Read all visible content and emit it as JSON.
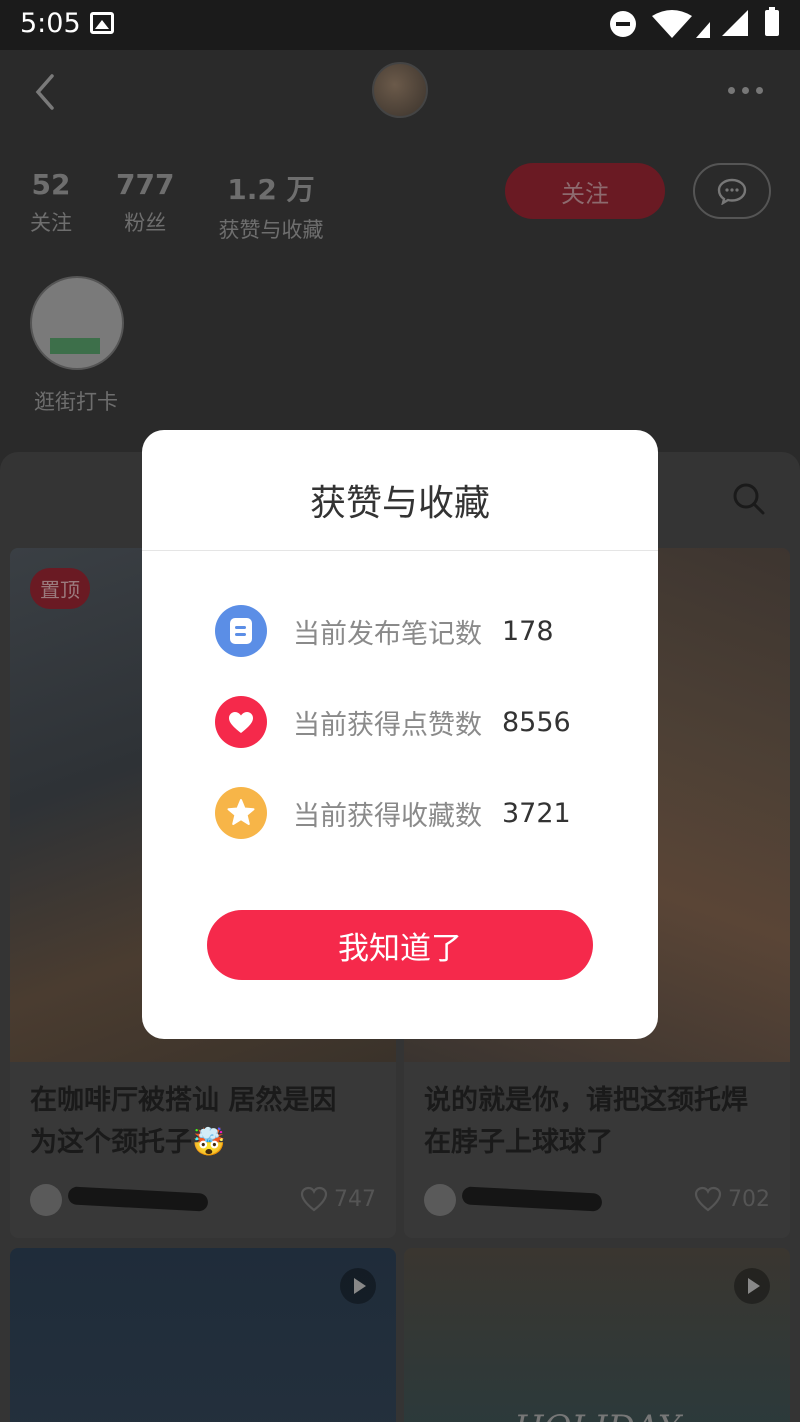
{
  "status_bar": {
    "time": "5:05"
  },
  "profile": {
    "stats": [
      {
        "num": "52",
        "label": "关注"
      },
      {
        "num": "777",
        "label": "粉丝"
      },
      {
        "num": "1.2 万",
        "label": "获赞与收藏"
      }
    ],
    "follow_label": "关注",
    "highlight_label": "逛街打卡"
  },
  "feed": {
    "pin_label": "置顶",
    "cards": [
      {
        "title_line1": "在咖啡厅被搭讪 居然是因",
        "title_line2": "为这个颈托子🤯",
        "likes": "747"
      },
      {
        "title_line1": "说的就是你，请把这颈托焊",
        "title_line2": "在脖子上球球了",
        "likes": "702"
      }
    ],
    "holiday_text": "HOLIDAY"
  },
  "modal": {
    "title": "获赞与收藏",
    "rows": [
      {
        "icon": "note-icon",
        "label": "当前发布笔记数",
        "value": "178",
        "color": "#5b8ee6"
      },
      {
        "icon": "heart-icon",
        "label": "当前获得点赞数",
        "value": "8556",
        "color": "#f5294b"
      },
      {
        "icon": "star-icon",
        "label": "当前获得收藏数",
        "value": "3721",
        "color": "#f7b548"
      }
    ],
    "ok_label": "我知道了"
  }
}
